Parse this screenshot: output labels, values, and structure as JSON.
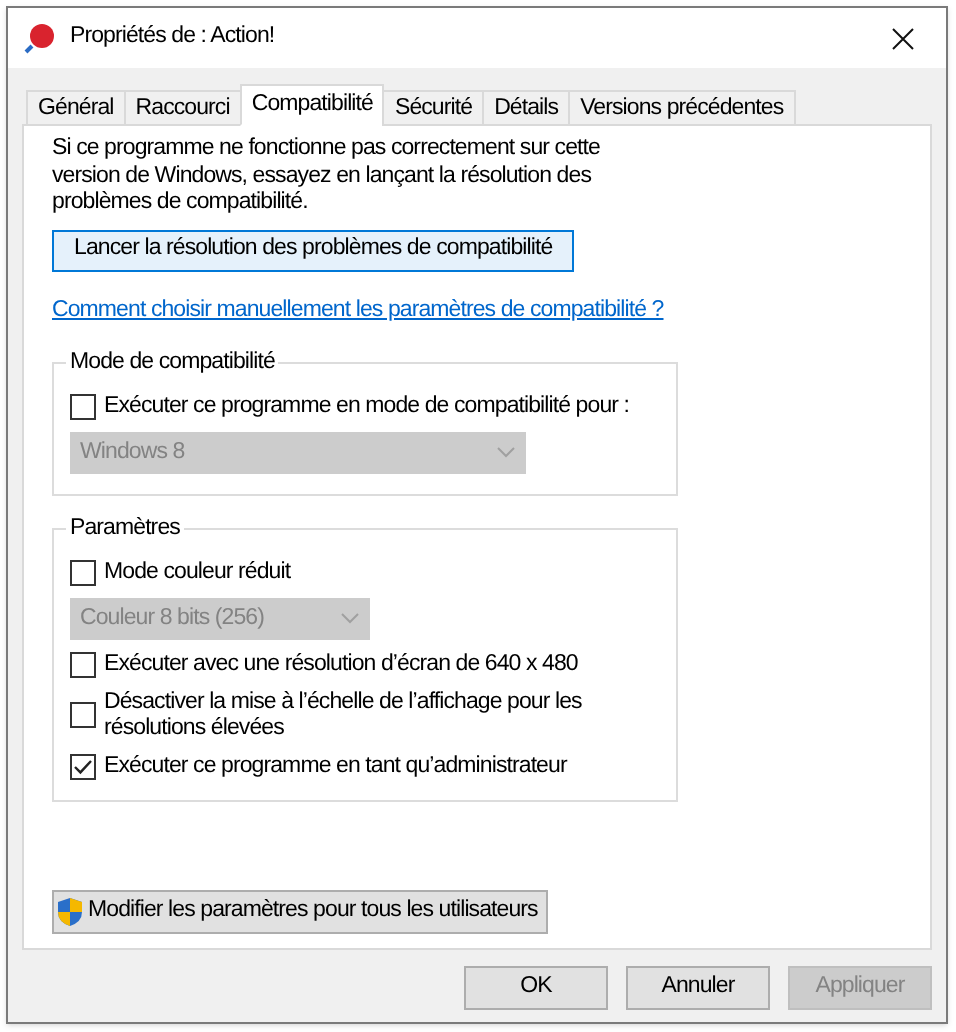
{
  "window": {
    "title": "Propriétés de : Action!"
  },
  "tabs": [
    {
      "label": "Général",
      "selected": false
    },
    {
      "label": "Raccourci",
      "selected": false
    },
    {
      "label": "Compatibilité",
      "selected": true
    },
    {
      "label": "Sécurité",
      "selected": false
    },
    {
      "label": "Détails",
      "selected": false
    },
    {
      "label": "Versions précédentes",
      "selected": false
    }
  ],
  "intro": "Si ce programme ne fonctionne pas correctement sur cette version de Windows, essayez en lançant la résolution des problèmes de compatibilité.",
  "troubleshoot_button": "Lancer la résolution des problèmes de compatibilité",
  "help_link": "Comment choisir manuellement les paramètres de compatibilité ?",
  "compat_group": {
    "title": "Mode de compatibilité",
    "items": [
      {
        "kind": "checkbox",
        "label": "Exécuter ce programme en mode de compatibilité pour :",
        "checked": false
      },
      {
        "kind": "dropdown",
        "value": "Windows 8",
        "disabled": true,
        "wide": true
      }
    ]
  },
  "settings_group": {
    "title": "Paramètres",
    "items": [
      {
        "kind": "checkbox",
        "label": "Mode couleur réduit",
        "checked": false
      },
      {
        "kind": "dropdown",
        "value": "Couleur 8 bits (256)",
        "disabled": true,
        "wide": false
      },
      {
        "kind": "checkbox",
        "label": "Exécuter avec une résolution d’écran de 640 x 480",
        "checked": false
      },
      {
        "kind": "checkbox",
        "label": "Désactiver la mise à l’échelle de l’affichage pour les résolutions élevées",
        "checked": false
      },
      {
        "kind": "checkbox",
        "label": "Exécuter ce programme en tant qu’administrateur",
        "checked": true
      }
    ]
  },
  "all_users_button": "Modifier les paramètres pour tous les utilisateurs",
  "buttons": [
    {
      "label": "OK",
      "disabled": false
    },
    {
      "label": "Annuler",
      "disabled": false
    },
    {
      "label": "Appliquer",
      "disabled": true
    }
  ]
}
